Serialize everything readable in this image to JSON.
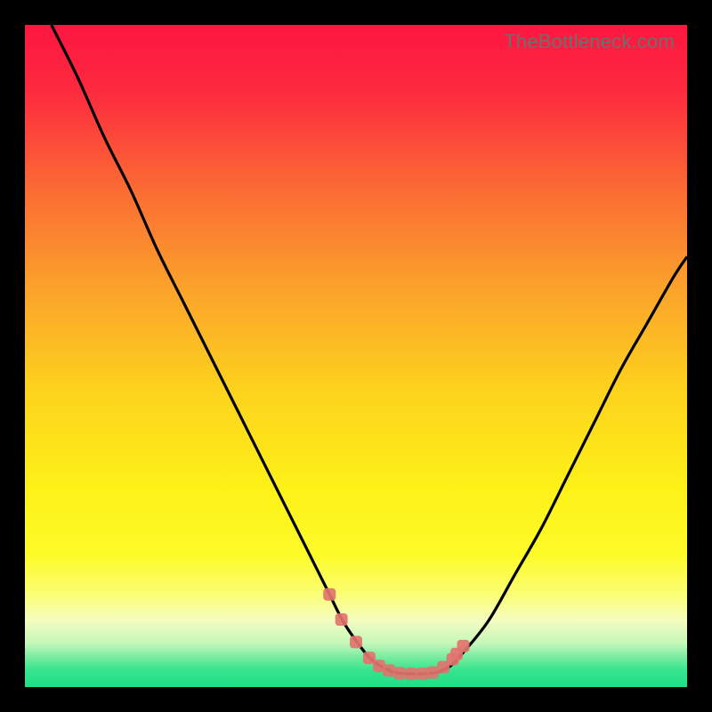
{
  "watermark": "TheBottleneck.com",
  "colors": {
    "frame": "#000000",
    "curve": "#000000",
    "marker": "#e2736e",
    "gradient_stops": [
      {
        "pos": 0.0,
        "color": "#fd1640"
      },
      {
        "pos": 0.1,
        "color": "#fd2a3f"
      },
      {
        "pos": 0.25,
        "color": "#fb6c34"
      },
      {
        "pos": 0.4,
        "color": "#fba32a"
      },
      {
        "pos": 0.55,
        "color": "#fdd21d"
      },
      {
        "pos": 0.7,
        "color": "#fdf118"
      },
      {
        "pos": 0.8,
        "color": "#fdfb28"
      },
      {
        "pos": 0.86,
        "color": "#fbfe74"
      },
      {
        "pos": 0.9,
        "color": "#f4fcc1"
      },
      {
        "pos": 0.935,
        "color": "#c2f7b9"
      },
      {
        "pos": 0.955,
        "color": "#77ec9f"
      },
      {
        "pos": 0.975,
        "color": "#36e48e"
      },
      {
        "pos": 1.0,
        "color": "#1ee086"
      }
    ]
  },
  "chart_data": {
    "type": "line",
    "title": "",
    "xlabel": "",
    "ylabel": "",
    "xlim": [
      0,
      100
    ],
    "ylim": [
      0,
      100
    ],
    "series": [
      {
        "name": "bottleneck-curve",
        "x": [
          4,
          8,
          12,
          16,
          20,
          24,
          28,
          32,
          36,
          40,
          44,
          46,
          48,
          50,
          52,
          54,
          56,
          58,
          60,
          62,
          64,
          66,
          70,
          74,
          78,
          82,
          86,
          90,
          94,
          98,
          100
        ],
        "y": [
          100,
          92,
          83,
          75,
          66,
          58,
          50,
          42,
          34,
          26,
          18,
          14,
          10,
          7,
          4.5,
          3,
          2.2,
          2,
          2,
          2.2,
          3,
          5,
          10,
          17,
          24,
          32,
          40,
          48,
          55,
          62,
          65
        ]
      }
    ],
    "markers": {
      "name": "highlight-points",
      "x": [
        46,
        47.8,
        50,
        52,
        53.5,
        55,
        56.6,
        58.4,
        60,
        61.6,
        63.2,
        64.6,
        65.2,
        66.2
      ],
      "y": [
        14,
        10.2,
        6.8,
        4.4,
        3.2,
        2.5,
        2.1,
        2,
        2,
        2.2,
        3,
        4.2,
        5,
        6.2
      ]
    }
  }
}
